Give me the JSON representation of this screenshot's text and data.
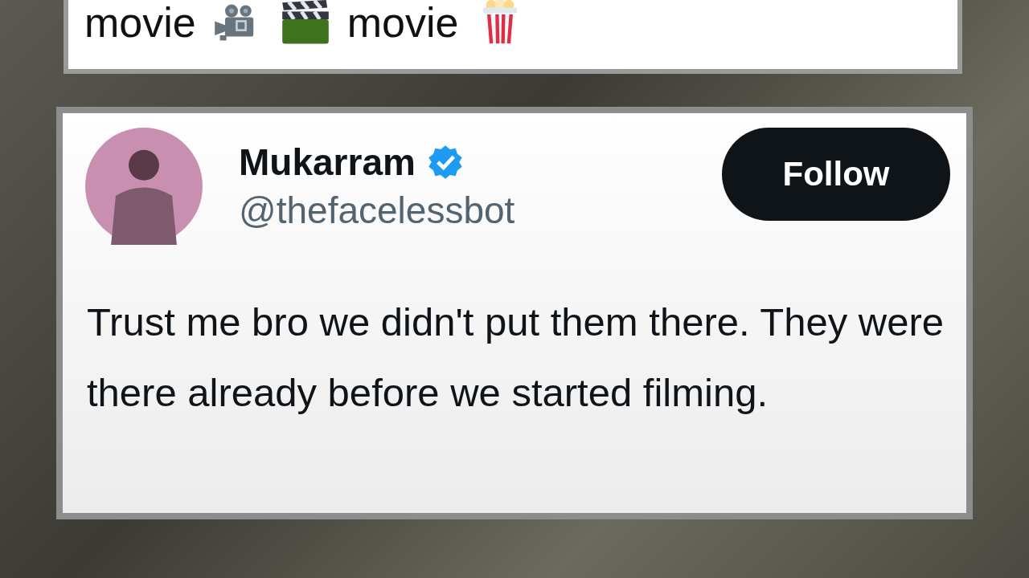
{
  "top_card": {
    "segments": [
      {
        "kind": "text",
        "text": "movie"
      },
      {
        "kind": "camera"
      },
      {
        "kind": "clapper"
      },
      {
        "kind": "text",
        "text": "movie"
      },
      {
        "kind": "popcorn"
      }
    ]
  },
  "tweet": {
    "name": "Mukarram",
    "verified": true,
    "handle": "@thefacelessbot",
    "follow_button": "Follow",
    "text": "Trust me bro we didn't put them there. They were there already before we started filming."
  }
}
